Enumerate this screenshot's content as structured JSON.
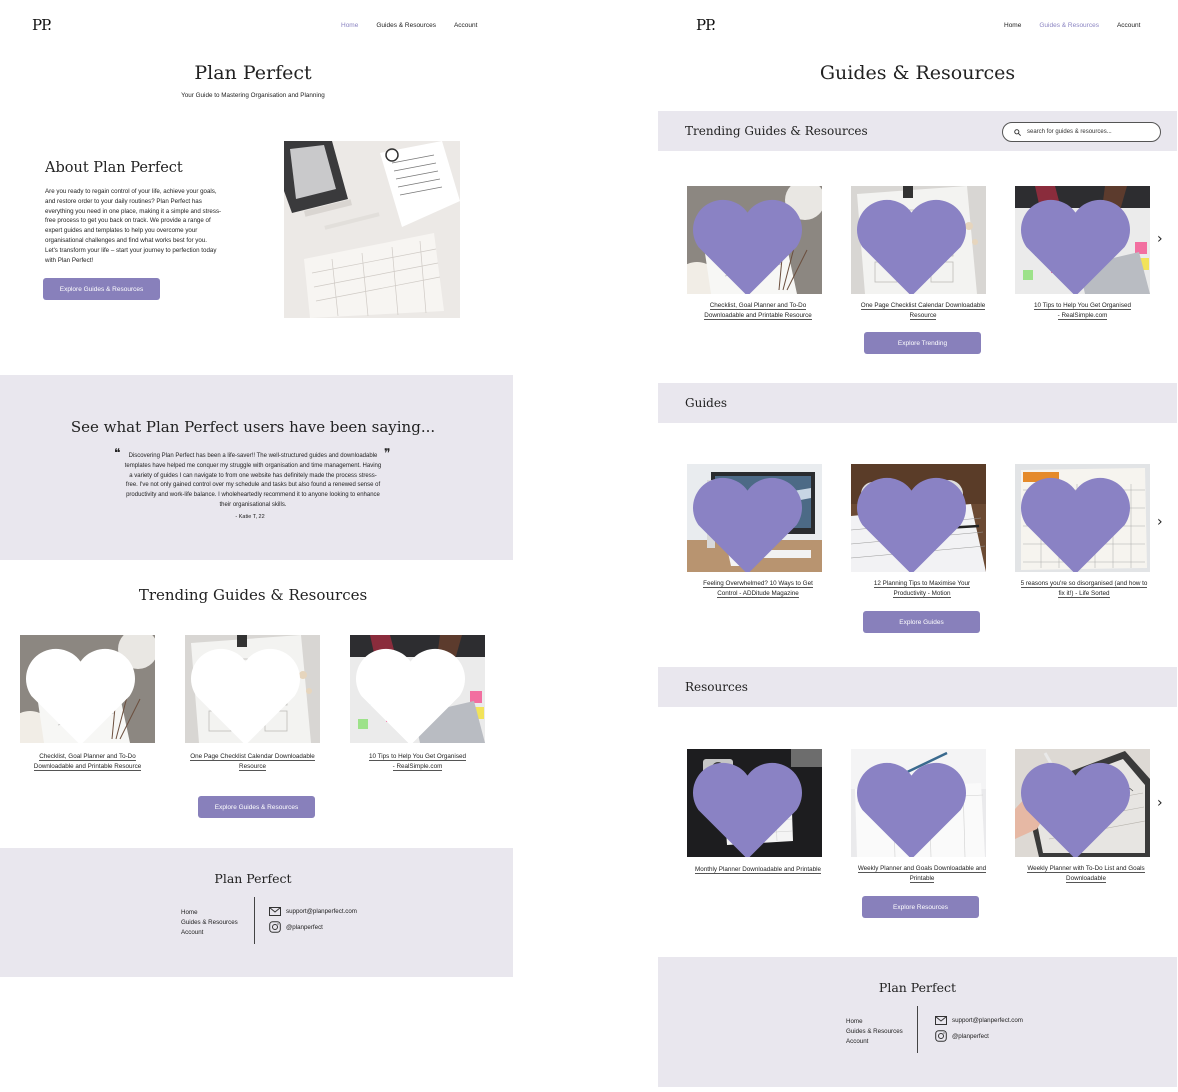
{
  "brand": {
    "logo": "PP.",
    "name": "Plan Perfect"
  },
  "nav": {
    "home": "Home",
    "guides": "Guides & Resources",
    "account": "Account"
  },
  "home": {
    "hero_title": "Plan Perfect",
    "hero_subtitle": "Your Guide to Mastering Organisation and Planning",
    "about_title": "About Plan Perfect",
    "about_lines": [
      "Are you ready to regain control of your life, achieve your goals,",
      "and restore order to your daily routines? Plan Perfect has",
      "everything you need in one place, making it a simple and stress-",
      "free process to get you back on track. We provide a range of",
      "expert guides and templates to help you overcome your",
      "organisational challenges and find what works best for you.",
      "Let's transform your life – start your journey to perfection today",
      "with Plan Perfect!"
    ],
    "about_button": "Explore Guides & Resources",
    "testimonial_title": "See what Plan Perfect users have been saying...",
    "testimonial_lines": [
      "Discovering Plan Perfect has been a life-saver!! The well-structured guides and downloadable",
      "templates have helped me conquer my struggle with organisation and time management. Having",
      "a variety of guides I can navigate to from one website has definitely made the process stress-",
      "free. I've not only gained control over my schedule and tasks but also found a renewed sense of",
      "productivity and work-life balance. I wholeheartedly recommend it to anyone looking to enhance",
      "their organisational skills."
    ],
    "testimonial_author": "- Katie T, 22",
    "trending_title": "Trending Guides & Resources",
    "trending_button": "Explore Guides & Resources"
  },
  "trending_cards": [
    {
      "line1": "Checklist, Goal Planner and To-Do",
      "line2": "Downloadable and Printable Resource"
    },
    {
      "line1": "One Page Checklist Calendar Downloadable",
      "line2": "Resource"
    },
    {
      "line1": "10 Tips to Help You Get Organised",
      "line2": "- RealSimple.com"
    }
  ],
  "guides_page": {
    "title": "Guides & Resources",
    "trending_heading": "Trending Guides & Resources",
    "search_placeholder": "search for guides & resources...",
    "trending_button": "Explore Trending",
    "guides_heading": "Guides",
    "guides_button": "Explore Guides",
    "resources_heading": "Resources",
    "resources_button": "Explore Resources"
  },
  "guide_cards": [
    {
      "line1": "Feeling Overwhelmed? 10 Ways to Get",
      "line2": "Control - ADDitude Magazine"
    },
    {
      "line1": "12 Planning Tips to Maximise Your",
      "line2": "Productivity - Motion"
    },
    {
      "line1": "5 reasons you're so disorganised (and how to",
      "line2": "fix it!) - Life Sorted"
    }
  ],
  "resource_cards": [
    {
      "line1": "Monthly Planner Downloadable and Printable",
      "line2": ""
    },
    {
      "line1": "Weekly Planner and Goals Downloadable and",
      "line2": "Printable"
    },
    {
      "line1": "Weekly Planner with To-Do List and Goals",
      "line2": "Downloadable"
    }
  ],
  "footer": {
    "title": "Plan Perfect",
    "links": [
      "Home",
      "Guides & Resources",
      "Account"
    ],
    "email": "support@planperfect.com",
    "instagram": "@planperfect"
  },
  "colors": {
    "accent": "#8880bb",
    "panel": "#e9e7ee",
    "heart": "#8a82c4"
  }
}
